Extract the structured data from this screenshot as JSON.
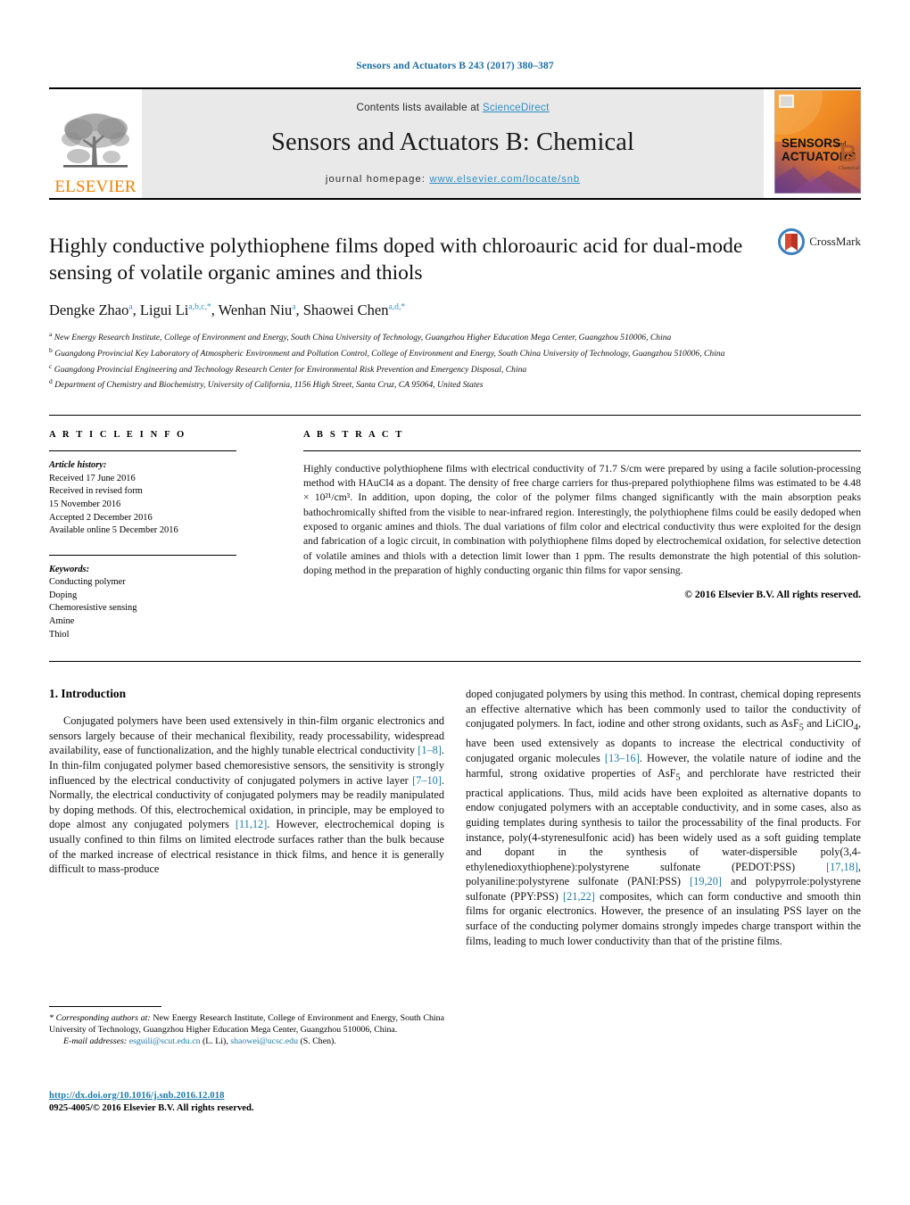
{
  "running_head": "Sensors and Actuators B 243 (2017) 380–387",
  "masthead": {
    "contents_prefix": "Contents lists available at ",
    "sciencedirect": "ScienceDirect",
    "journal_title": "Sensors and Actuators B: Chemical",
    "homepage_prefix": "journal homepage: ",
    "homepage_url": "www.elsevier.com/locate/snb",
    "publisher_wordmark": "ELSEVIER",
    "cover_line1": "SENSORS",
    "cover_and": "and",
    "cover_line2": "ACTUATORS",
    "cover_letter": "B",
    "cover_sub": "Chemical"
  },
  "article": {
    "title": "Highly conductive polythiophene films doped with chloroauric acid for dual-mode sensing of volatile organic amines and thiols",
    "crossmark_label": "CrossMark",
    "authors_html": "Dengke Zhao<sup>a</sup>, Ligui Li<sup>a,b,c,*</sup>, Wenhan Niu<sup>a</sup>, Shaowei Chen<sup>a,d,*</sup>",
    "affiliations": [
      {
        "marker": "a",
        "text": "New Energy Research Institute, College of Environment and Energy, South China University of Technology, Guangzhou Higher Education Mega Center, Guangzhou 510006, China"
      },
      {
        "marker": "b",
        "text": "Guangdong Provincial Key Laboratory of Atmospheric Environment and Pollution Control, College of Environment and Energy, South China University of Technology, Guangzhou 510006, China"
      },
      {
        "marker": "c",
        "text": "Guangdong Provincial Engineering and Technology Research Center for Environmental Risk Prevention and Emergency Disposal, China"
      },
      {
        "marker": "d",
        "text": "Department of Chemistry and Biochemistry, University of California, 1156 High Street, Santa Cruz, CA 95064, United States"
      }
    ]
  },
  "article_info": {
    "heading": "A R T I C L E   I N F O",
    "history_label": "Article history:",
    "history": [
      "Received 17 June 2016",
      "Received in revised form",
      "15 November 2016",
      "Accepted 2 December 2016",
      "Available online 5 December 2016"
    ],
    "keywords_label": "Keywords:",
    "keywords": [
      "Conducting polymer",
      "Doping",
      "Chemoresistive sensing",
      "Amine",
      "Thiol"
    ]
  },
  "abstract": {
    "heading": "A B S T R A C T",
    "text": "Highly conductive polythiophene films with electrical conductivity of 71.7 S/cm were prepared by using a facile solution-processing method with HAuCl4 as a dopant. The density of free charge carriers for thus-prepared polythiophene films was estimated to be 4.48 × 10²¹/cm³. In addition, upon doping, the color of the polymer films changed significantly with the main absorption peaks bathochromically shifted from the visible to near-infrared region. Interestingly, the polythiophene films could be easily dedoped when exposed to organic amines and thiols. The dual variations of film color and electrical conductivity thus were exploited for the design and fabrication of a logic circuit, in combination with polythiophene films doped by electrochemical oxidation, for selective detection of volatile amines and thiols with a detection limit lower than 1 ppm. The results demonstrate the high potential of this solution-doping method in the preparation of highly conducting organic thin films for vapor sensing.",
    "copyright": "© 2016 Elsevier B.V. All rights reserved."
  },
  "body": {
    "section_number_title": "1.  Introduction",
    "left_paragraph_html": "Conjugated polymers have been used extensively in thin-film organic electronics and sensors largely because of their mechanical flexibility, ready processability, widespread availability, ease of functionalization, and the highly tunable electrical conductivity <span class=\"ref\">[1–8]</span>. In thin-film conjugated polymer based chemoresistive sensors, the sensitivity is strongly influenced by the electrical conductivity of conjugated polymers in active layer <span class=\"ref\">[7–10]</span>. Normally, the electrical conductivity of conjugated polymers may be readily manipulated by doping methods. Of this, electrochemical oxidation, in principle, may be employed to dope almost any conjugated polymers <span class=\"ref\">[11,12]</span>. However, electrochemical doping is usually confined to thin films on limited electrode surfaces rather than the bulk because of the marked increase of electrical resistance in thick films, and hence it is generally difficult to mass-produce",
    "right_paragraph_html": "doped conjugated polymers by using this method. In contrast, chemical doping represents an effective alternative which has been commonly used to tailor the conductivity of conjugated polymers. In fact, iodine and other strong oxidants, such as AsF<sub>5</sub> and LiClO<sub>4</sub>, have been used extensively as dopants to increase the electrical conductivity of conjugated organic molecules <span class=\"ref\">[13–16]</span>. However, the volatile nature of iodine and the harmful, strong oxidative properties of AsF<sub>5</sub> and perchlorate have restricted their practical applications. Thus, mild acids have been exploited as alternative dopants to endow conjugated polymers with an acceptable conductivity, and in some cases, also as guiding templates during synthesis to tailor the processability of the final products. For instance, poly(4-styrenesulfonic acid) has been widely used as a soft guiding template and dopant in the synthesis of water-dispersible poly(3,4-ethylenedioxythiophene):polystyrene sulfonate (PEDOT:PSS) <span class=\"ref\">[17,18]</span>, polyaniline:polystyrene sulfonate (PANI:PSS) <span class=\"ref\">[19,20]</span> and polypyrrole:polystyrene sulfonate (PPY:PSS) <span class=\"ref\">[21,22]</span> composites, which can form conductive and smooth thin films for organic electronics. However, the presence of an insulating PSS layer on the surface of the conducting polymer domains strongly impedes charge transport within the films, leading to much lower conductivity than that of the pristine films."
  },
  "footnotes": {
    "corresponding_html": "<span class=\"it\">*  Corresponding authors at:</span> New Energy Research Institute, College of Environment and Energy, South China University of Technology, Guangzhou Higher Education Mega Center, Guangzhou 510006, China.",
    "email_html": "<span class=\"it\">E-mail addresses:</span> <span class=\"fn-link\">esguili@scut.edu.cn</span> (L. Li), <span class=\"fn-link\">shaowei@ucsc.edu</span> (S. Chen).",
    "doi": "http://dx.doi.org/10.1016/j.snb.2016.12.018",
    "issn": "0925-4005/© 2016 Elsevier B.V. All rights reserved."
  },
  "colors": {
    "link_blue": "#2e8fc4",
    "ref_blue": "#1c7aa8",
    "elsevier_orange": "#ef8200",
    "band_gray": "#e9e9ea"
  }
}
